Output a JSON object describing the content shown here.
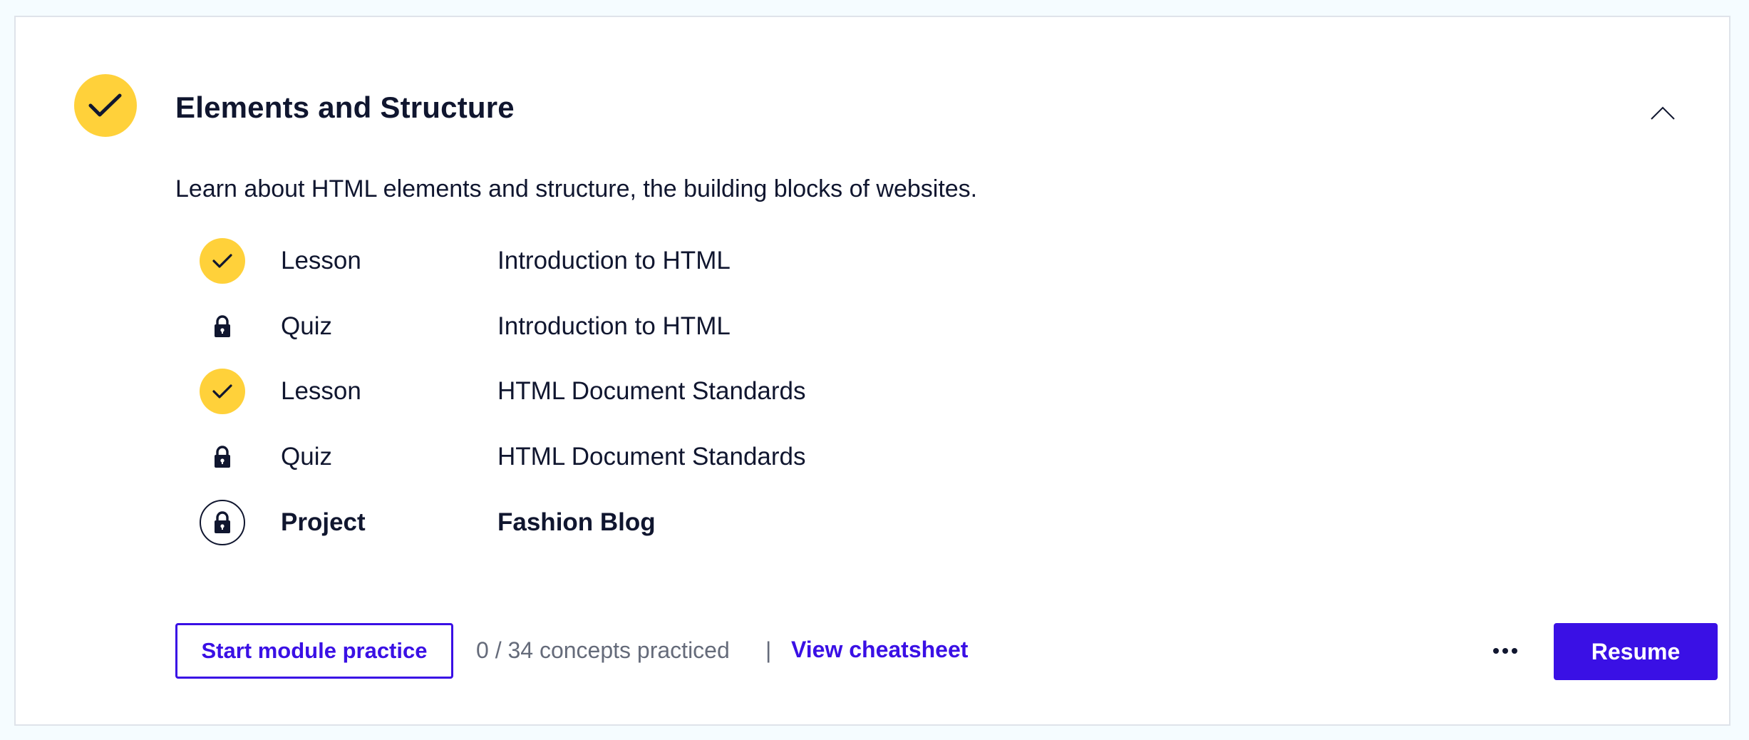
{
  "module": {
    "title": "Elements and Structure",
    "description": "Learn about HTML elements and structure, the building blocks of websites.",
    "status_icon": "check-icon",
    "accent_color": "#ffd13a",
    "collapse_icon": "chevron-up-icon"
  },
  "items": [
    {
      "type": "Lesson",
      "name": "Introduction to HTML",
      "status": "completed",
      "icon": "check-icon"
    },
    {
      "type": "Quiz",
      "name": "Introduction to HTML",
      "status": "locked",
      "icon": "lock-icon"
    },
    {
      "type": "Lesson",
      "name": "HTML Document Standards",
      "status": "completed",
      "icon": "check-icon"
    },
    {
      "type": "Quiz",
      "name": "HTML Document Standards",
      "status": "locked",
      "icon": "lock-icon"
    },
    {
      "type": "Project",
      "name": "Fashion Blog",
      "status": "locked-current",
      "icon": "lock-icon"
    }
  ],
  "footer": {
    "practice_button_label": "Start module practice",
    "progress_text": "0 / 34 concepts practiced",
    "divider": "|",
    "cheatsheet_label": "View cheatsheet",
    "more_icon": "ellipsis-icon",
    "resume_button_label": "Resume",
    "primary_color": "#3a10e5"
  }
}
